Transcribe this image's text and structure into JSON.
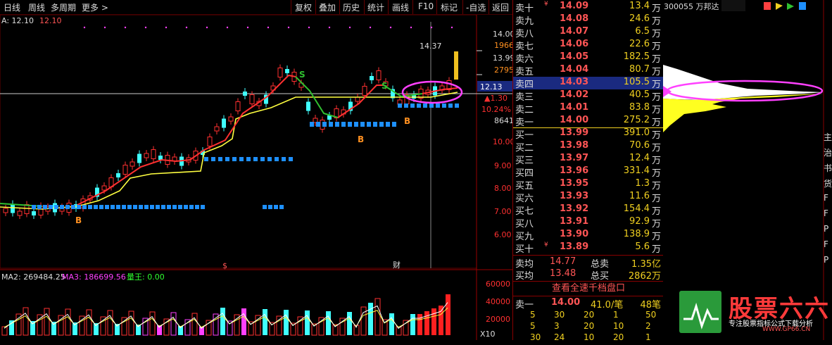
{
  "toolbar": {
    "left": [
      "日线",
      "周线",
      "多周期",
      "更多 >"
    ],
    "right": [
      "复权",
      "叠加",
      "历史",
      "统计",
      "画线",
      "F10",
      "标记",
      "-自选",
      "返回"
    ]
  },
  "chart": {
    "ma_label": "A: 12.10",
    "ma_value": "12.10",
    "price_axis": [
      "14.00",
      "13.99",
      "10.00",
      "9.00",
      "8.00",
      "7.00",
      "6.00"
    ],
    "axis_extra": [
      "1966",
      "2795"
    ],
    "current_price": "12.13",
    "change": "▲1.30",
    "change_pct": "10.24%",
    "volume_now": "8641",
    "high_marker": "14.37",
    "b_markers": [
      "B",
      "B",
      "B"
    ],
    "s_markers": [
      "S",
      "S"
    ],
    "bottom_markers": [
      "$",
      "财"
    ],
    "volume_legend": {
      "ma2": "MA2: 269484.25",
      "ma3": "MA3: 186699.56",
      "ratio": "量王: 0.00"
    },
    "volume_axis": [
      "60000",
      "40000",
      "20000"
    ],
    "volume_unit": "X10"
  },
  "orderbook": {
    "sell": [
      {
        "label": "卖十",
        "mark": "¥",
        "price": "14.09",
        "volume": "13.4"
      },
      {
        "label": "卖九",
        "mark": "",
        "price": "14.08",
        "volume": "24.6"
      },
      {
        "label": "卖八",
        "mark": "",
        "price": "14.07",
        "volume": "6.5"
      },
      {
        "label": "卖七",
        "mark": "",
        "price": "14.06",
        "volume": "22.6"
      },
      {
        "label": "卖六",
        "mark": "",
        "price": "14.05",
        "volume": "182.5"
      },
      {
        "label": "卖五",
        "mark": "",
        "price": "14.04",
        "volume": "80.7"
      },
      {
        "label": "卖四",
        "mark": "",
        "price": "14.03",
        "volume": "105.5"
      },
      {
        "label": "卖三",
        "mark": "",
        "price": "14.02",
        "volume": "40.5"
      },
      {
        "label": "卖二",
        "mark": "",
        "price": "14.01",
        "volume": "83.8"
      },
      {
        "label": "卖一",
        "mark": "",
        "price": "14.00",
        "volume": "275.2"
      }
    ],
    "buy": [
      {
        "label": "买一",
        "mark": "",
        "price": "13.99",
        "volume": "391.0"
      },
      {
        "label": "买二",
        "mark": "",
        "price": "13.98",
        "volume": "70.6"
      },
      {
        "label": "买三",
        "mark": "",
        "price": "13.97",
        "volume": "12.4"
      },
      {
        "label": "买四",
        "mark": "",
        "price": "13.96",
        "volume": "331.4"
      },
      {
        "label": "买五",
        "mark": "",
        "price": "13.95",
        "volume": "1.3"
      },
      {
        "label": "买六",
        "mark": "",
        "price": "13.93",
        "volume": "11.6"
      },
      {
        "label": "买七",
        "mark": "",
        "price": "13.92",
        "volume": "154.4"
      },
      {
        "label": "买八",
        "mark": "",
        "price": "13.91",
        "volume": "92.9"
      },
      {
        "label": "买九",
        "mark": "",
        "price": "13.90",
        "volume": "138.9"
      },
      {
        "label": "买十",
        "mark": "¥",
        "price": "13.89",
        "volume": "5.6"
      }
    ],
    "unit": "万",
    "summary": [
      {
        "label": "卖均",
        "value": "14.77",
        "label2": "总卖",
        "value2": "1.35亿"
      },
      {
        "label": "买均",
        "value": "13.48",
        "label2": "总买",
        "value2": "2862万"
      }
    ],
    "view_all_button": "查看全速千档盘口",
    "ticket": {
      "label": "卖一",
      "price": "14.00",
      "amount": "41.0/笔",
      "count": "48笔"
    },
    "ticket_rows": [
      [
        "5",
        "30",
        "20",
        "1",
        "50"
      ],
      [
        "5",
        "3",
        "20",
        "10",
        "2"
      ],
      [
        "30",
        "24",
        "10",
        "20",
        "1"
      ]
    ]
  },
  "depth": {
    "stock_title": "300055 万邦达",
    "right_edge_chars": [
      "主",
      "治",
      "书",
      "货",
      "F",
      "F",
      "P",
      "F",
      "P"
    ]
  },
  "logo": {
    "name": "股票六六",
    "tagline": "专注股票指标公式下载分析",
    "url": "WWW.GP66.CN"
  },
  "colors": {
    "up": "#ff3030",
    "down": "#1e90ff",
    "cyan": "#40ffff",
    "magenta": "#ff40ff",
    "yellow": "#ffff40",
    "green": "#30c030"
  }
}
